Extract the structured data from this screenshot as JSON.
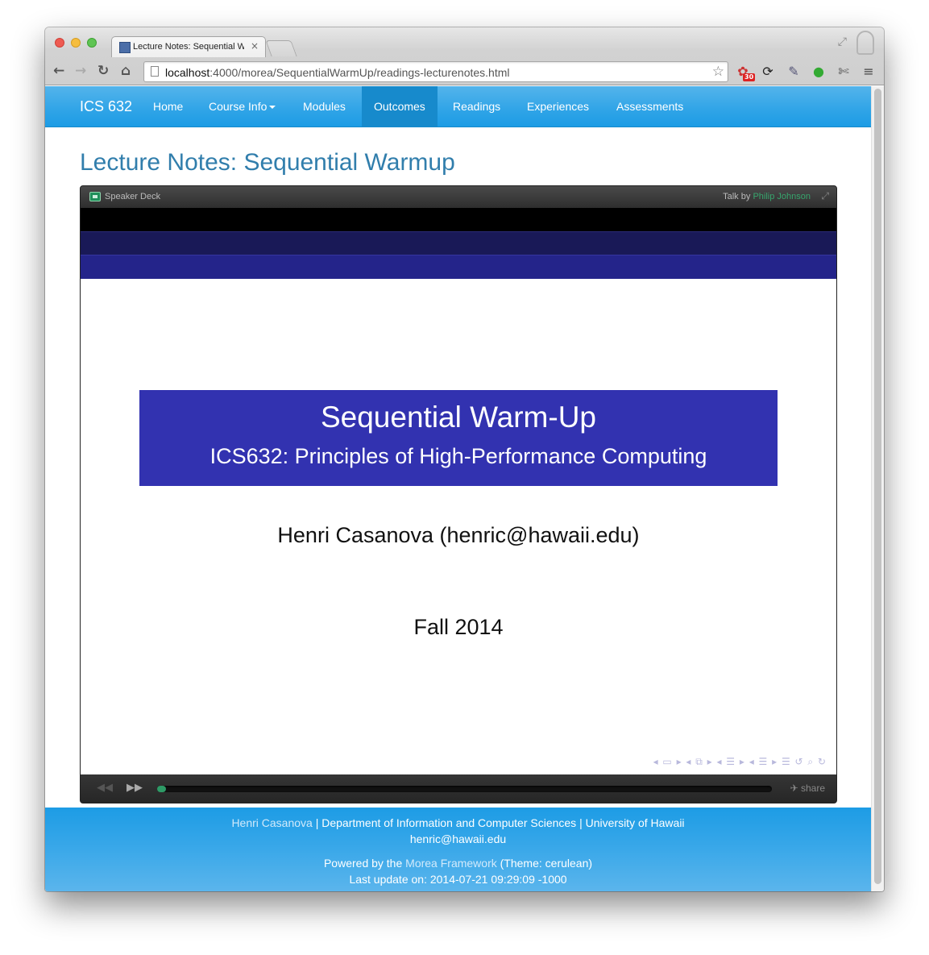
{
  "browser": {
    "tab_title": "Lecture Notes: Sequential W",
    "tab_close": "×",
    "url_host": "localhost",
    "url_rest": ":4000/morea/SequentialWarmUp/readings-lecturenotes.html",
    "extension_badge": "30"
  },
  "navbar": {
    "brand": "ICS 632",
    "items": [
      {
        "label": "Home"
      },
      {
        "label": "Course Info"
      },
      {
        "label": "Modules"
      },
      {
        "label": "Outcomes",
        "active": true
      },
      {
        "label": "Readings"
      },
      {
        "label": "Experiences"
      },
      {
        "label": "Assessments"
      }
    ]
  },
  "page": {
    "title": "Lecture Notes: Sequential Warmup"
  },
  "speakerdeck": {
    "name": "Speaker Deck",
    "talk_by": "Talk by",
    "author": "Philip Johnson",
    "share": "share",
    "progress": 0.01,
    "slide": {
      "title": "Sequential Warm-Up",
      "subtitle": "ICS632: Principles of High-Performance Computing",
      "author": "Henri Casanova (henric@hawaii.edu)",
      "date": "Fall 2014"
    }
  },
  "footer": {
    "name": "Henri Casanova",
    "sep": "|",
    "department": "Department of Information and Computer Sciences",
    "university": "University of Hawaii",
    "email": "henric@hawaii.edu",
    "powered_prefix": "Powered by the",
    "framework": "Morea Framework",
    "theme": "(Theme: cerulean)",
    "last_update": "Last update on: 2014-07-21 09:29:09 -1000"
  },
  "colors": {
    "navbar": "#2fa4e7",
    "title": "#317eac",
    "slide_box": "#3232b0",
    "progress": "#2e9a66"
  }
}
